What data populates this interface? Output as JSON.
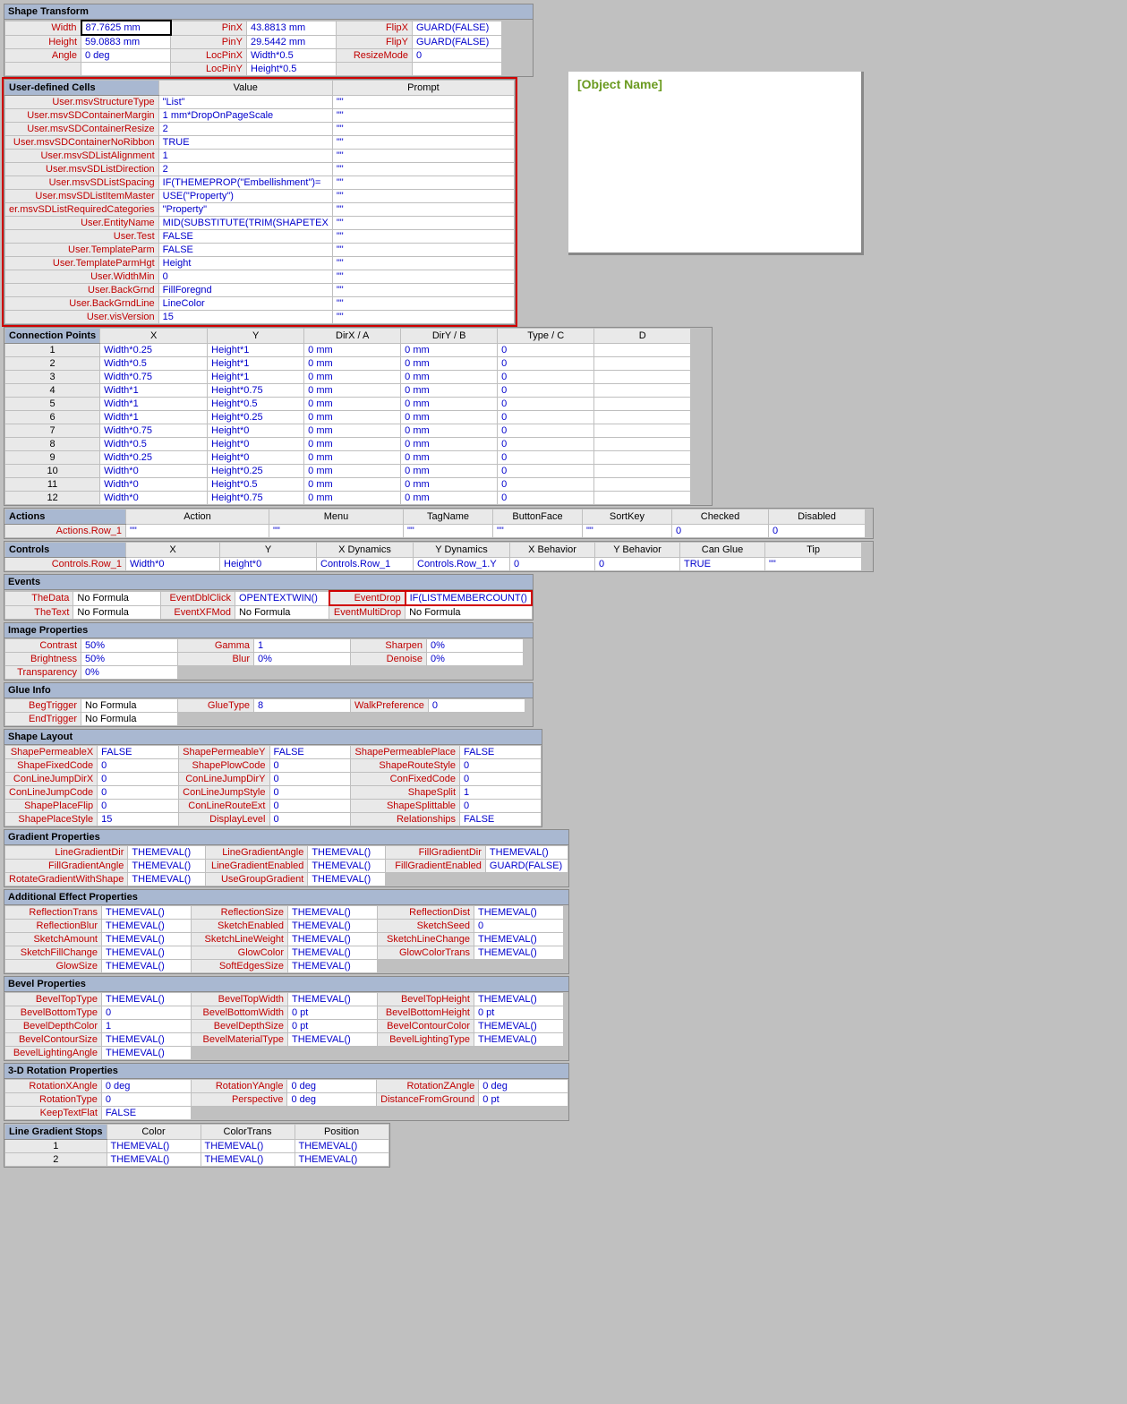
{
  "preview_title": "[Object Name]",
  "shape_transform": {
    "title": "Shape Transform",
    "rows": [
      [
        "Width",
        "87.7625 mm",
        "PinX",
        "43.8813 mm",
        "FlipX",
        "GUARD(FALSE)"
      ],
      [
        "Height",
        "59.0883 mm",
        "PinY",
        "29.5442 mm",
        "FlipY",
        "GUARD(FALSE)"
      ],
      [
        "Angle",
        "0 deg",
        "LocPinX",
        "Width*0.5",
        "ResizeMode",
        "0"
      ],
      [
        "",
        "",
        "LocPinY",
        "Height*0.5",
        "",
        ""
      ]
    ]
  },
  "user_cells": {
    "title": "User-defined Cells",
    "headers": [
      "",
      "Value",
      "Prompt"
    ],
    "rows": [
      [
        "User.msvStructureType",
        "\"List\"",
        "\"\""
      ],
      [
        "User.msvSDContainerMargin",
        "1 mm*DropOnPageScale",
        "\"\""
      ],
      [
        "User.msvSDContainerResize",
        "2",
        "\"\""
      ],
      [
        "User.msvSDContainerNoRibbon",
        "TRUE",
        "\"\""
      ],
      [
        "User.msvSDListAlignment",
        "1",
        "\"\""
      ],
      [
        "User.msvSDListDirection",
        "2",
        "\"\""
      ],
      [
        "User.msvSDListSpacing",
        "IF(THEMEPROP(\"Embellishment\")=",
        "\"\""
      ],
      [
        "User.msvSDListItemMaster",
        "USE(\"Property\")",
        "\"\""
      ],
      [
        "er.msvSDListRequiredCategories",
        "\"Property\"",
        "\"\""
      ],
      [
        "User.EntityName",
        "MID(SUBSTITUTE(TRIM(SHAPETEX",
        "\"\""
      ],
      [
        "User.Test",
        "FALSE",
        "\"\""
      ],
      [
        "User.TemplateParm",
        "FALSE",
        "\"\""
      ],
      [
        "User.TemplateParmHgt",
        "Height",
        "\"\""
      ],
      [
        "User.WidthMin",
        "0",
        "\"\""
      ],
      [
        "User.BackGrnd",
        "FillForegnd",
        "\"\""
      ],
      [
        "User.BackGrndLine",
        "LineColor",
        "\"\""
      ],
      [
        "User.visVersion",
        "15",
        "\"\""
      ]
    ]
  },
  "connection_points": {
    "title": "Connection Points",
    "headers": [
      "",
      "X",
      "Y",
      "DirX / A",
      "DirY / B",
      "Type / C",
      "D"
    ],
    "rows": [
      [
        "1",
        "Width*0.25",
        "Height*1",
        "0 mm",
        "0 mm",
        "0",
        ""
      ],
      [
        "2",
        "Width*0.5",
        "Height*1",
        "0 mm",
        "0 mm",
        "0",
        ""
      ],
      [
        "3",
        "Width*0.75",
        "Height*1",
        "0 mm",
        "0 mm",
        "0",
        ""
      ],
      [
        "4",
        "Width*1",
        "Height*0.75",
        "0 mm",
        "0 mm",
        "0",
        ""
      ],
      [
        "5",
        "Width*1",
        "Height*0.5",
        "0 mm",
        "0 mm",
        "0",
        ""
      ],
      [
        "6",
        "Width*1",
        "Height*0.25",
        "0 mm",
        "0 mm",
        "0",
        ""
      ],
      [
        "7",
        "Width*0.75",
        "Height*0",
        "0 mm",
        "0 mm",
        "0",
        ""
      ],
      [
        "8",
        "Width*0.5",
        "Height*0",
        "0 mm",
        "0 mm",
        "0",
        ""
      ],
      [
        "9",
        "Width*0.25",
        "Height*0",
        "0 mm",
        "0 mm",
        "0",
        ""
      ],
      [
        "10",
        "Width*0",
        "Height*0.25",
        "0 mm",
        "0 mm",
        "0",
        ""
      ],
      [
        "11",
        "Width*0",
        "Height*0.5",
        "0 mm",
        "0 mm",
        "0",
        ""
      ],
      [
        "12",
        "Width*0",
        "Height*0.75",
        "0 mm",
        "0 mm",
        "0",
        ""
      ]
    ]
  },
  "actions": {
    "title": "Actions",
    "headers": [
      "",
      "Action",
      "Menu",
      "TagName",
      "ButtonFace",
      "SortKey",
      "Checked",
      "Disabled"
    ],
    "row": [
      "Actions.Row_1",
      "\"\"",
      "\"\"",
      "\"\"",
      "\"\"",
      "\"\"",
      "0",
      "0"
    ]
  },
  "controls": {
    "title": "Controls",
    "headers": [
      "",
      "X",
      "Y",
      "X Dynamics",
      "Y Dynamics",
      "X Behavior",
      "Y Behavior",
      "Can Glue",
      "Tip"
    ],
    "row": [
      "Controls.Row_1",
      "Width*0",
      "Height*0",
      "Controls.Row_1",
      "Controls.Row_1.Y",
      "0",
      "0",
      "TRUE",
      "\"\""
    ]
  },
  "events": {
    "title": "Events",
    "rows": [
      [
        "TheData",
        "No Formula",
        "EventDblClick",
        "OPENTEXTWIN()",
        "EventDrop",
        "IF(LISTMEMBERCOUNT()"
      ],
      [
        "TheText",
        "No Formula",
        "EventXFMod",
        "No Formula",
        "EventMultiDrop",
        "No Formula"
      ]
    ]
  },
  "image_props": {
    "title": "Image Properties",
    "rows": [
      [
        "Contrast",
        "50%",
        "Gamma",
        "1",
        "Sharpen",
        "0%"
      ],
      [
        "Brightness",
        "50%",
        "Blur",
        "0%",
        "Denoise",
        "0%"
      ],
      [
        "Transparency",
        "0%",
        "",
        "",
        "",
        ""
      ]
    ]
  },
  "glue_info": {
    "title": "Glue Info",
    "rows": [
      [
        "BegTrigger",
        "No Formula",
        "GlueType",
        "8",
        "WalkPreference",
        "0"
      ],
      [
        "EndTrigger",
        "No Formula",
        "",
        "",
        "",
        ""
      ]
    ]
  },
  "shape_layout": {
    "title": "Shape Layout",
    "rows": [
      [
        "ShapePermeableX",
        "FALSE",
        "ShapePermeableY",
        "FALSE",
        "ShapePermeablePlace",
        "FALSE"
      ],
      [
        "ShapeFixedCode",
        "0",
        "ShapePlowCode",
        "0",
        "ShapeRouteStyle",
        "0"
      ],
      [
        "ConLineJumpDirX",
        "0",
        "ConLineJumpDirY",
        "0",
        "ConFixedCode",
        "0"
      ],
      [
        "ConLineJumpCode",
        "0",
        "ConLineJumpStyle",
        "0",
        "ShapeSplit",
        "1"
      ],
      [
        "ShapePlaceFlip",
        "0",
        "ConLineRouteExt",
        "0",
        "ShapeSplittable",
        "0"
      ],
      [
        "ShapePlaceStyle",
        "15",
        "DisplayLevel",
        "0",
        "Relationships",
        "FALSE"
      ]
    ]
  },
  "gradient_props": {
    "title": "Gradient Properties",
    "rows": [
      [
        "LineGradientDir",
        "THEMEVAL()",
        "LineGradientAngle",
        "THEMEVAL()",
        "FillGradientDir",
        "THEMEVAL()"
      ],
      [
        "FillGradientAngle",
        "THEMEVAL()",
        "LineGradientEnabled",
        "THEMEVAL()",
        "FillGradientEnabled",
        "GUARD(FALSE)"
      ],
      [
        "RotateGradientWithShape",
        "THEMEVAL()",
        "UseGroupGradient",
        "THEMEVAL()",
        "",
        ""
      ]
    ]
  },
  "effect_props": {
    "title": "Additional Effect Properties",
    "rows": [
      [
        "ReflectionTrans",
        "THEMEVAL()",
        "ReflectionSize",
        "THEMEVAL()",
        "ReflectionDist",
        "THEMEVAL()"
      ],
      [
        "ReflectionBlur",
        "THEMEVAL()",
        "SketchEnabled",
        "THEMEVAL()",
        "SketchSeed",
        "0"
      ],
      [
        "SketchAmount",
        "THEMEVAL()",
        "SketchLineWeight",
        "THEMEVAL()",
        "SketchLineChange",
        "THEMEVAL()"
      ],
      [
        "SketchFillChange",
        "THEMEVAL()",
        "GlowColor",
        "THEMEVAL()",
        "GlowColorTrans",
        "THEMEVAL()"
      ],
      [
        "GlowSize",
        "THEMEVAL()",
        "SoftEdgesSize",
        "THEMEVAL()",
        "",
        ""
      ]
    ]
  },
  "bevel_props": {
    "title": "Bevel Properties",
    "rows": [
      [
        "BevelTopType",
        "THEMEVAL()",
        "BevelTopWidth",
        "THEMEVAL()",
        "BevelTopHeight",
        "THEMEVAL()"
      ],
      [
        "BevelBottomType",
        "0",
        "BevelBottomWidth",
        "0 pt",
        "BevelBottomHeight",
        "0 pt"
      ],
      [
        "BevelDepthColor",
        "1",
        "BevelDepthSize",
        "0 pt",
        "BevelContourColor",
        "THEMEVAL()"
      ],
      [
        "BevelContourSize",
        "THEMEVAL()",
        "BevelMaterialType",
        "THEMEVAL()",
        "BevelLightingType",
        "THEMEVAL()"
      ],
      [
        "BevelLightingAngle",
        "THEMEVAL()",
        "",
        "",
        "",
        ""
      ]
    ]
  },
  "rotation_props": {
    "title": "3-D Rotation Properties",
    "rows": [
      [
        "RotationXAngle",
        "0 deg",
        "RotationYAngle",
        "0 deg",
        "RotationZAngle",
        "0 deg"
      ],
      [
        "RotationType",
        "0",
        "Perspective",
        "0 deg",
        "DistanceFromGround",
        "0 pt"
      ],
      [
        "KeepTextFlat",
        "FALSE",
        "",
        "",
        "",
        ""
      ]
    ]
  },
  "line_grad_stops": {
    "title": "Line Gradient Stops",
    "headers": [
      "",
      "Color",
      "ColorTrans",
      "Position"
    ],
    "rows": [
      [
        "1",
        "THEMEVAL()",
        "THEMEVAL()",
        "THEMEVAL()"
      ],
      [
        "2",
        "THEMEVAL()",
        "THEMEVAL()",
        "THEMEVAL()"
      ]
    ]
  }
}
